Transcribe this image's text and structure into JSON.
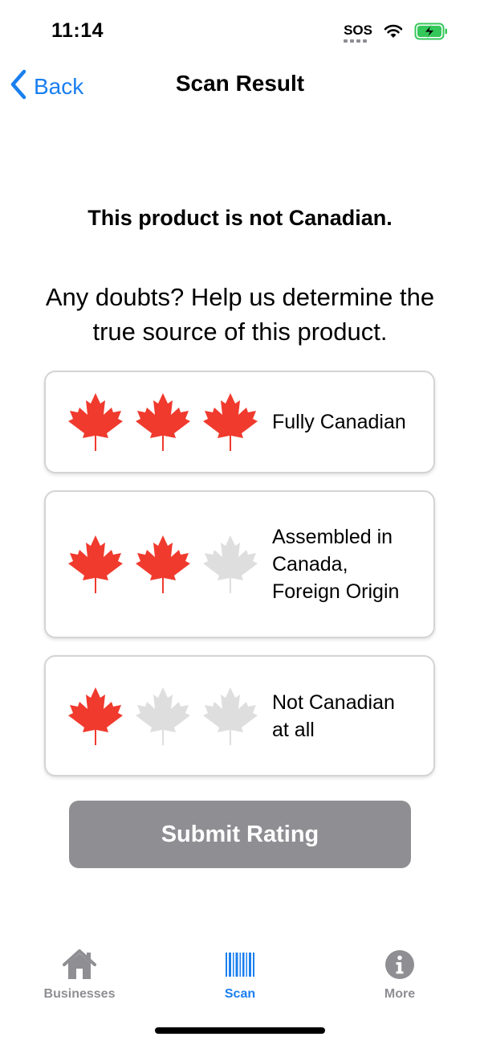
{
  "status_bar": {
    "time": "11:14",
    "sos": "SOS"
  },
  "nav": {
    "back_label": "Back",
    "title": "Scan Result"
  },
  "headline": "This product is not Canadian.",
  "prompt": "Any doubts? Help us determine the true source of this product.",
  "options": [
    {
      "label": "Fully Canadian",
      "rating": 3,
      "max": 3
    },
    {
      "label": "Assembled in Canada, Foreign Origin",
      "rating": 2,
      "max": 3
    },
    {
      "label": "Not Canadian at all",
      "rating": 1,
      "max": 3
    }
  ],
  "submit_label": "Submit Rating",
  "tabs": [
    {
      "label": "Businesses",
      "icon": "house-icon",
      "active": false
    },
    {
      "label": "Scan",
      "icon": "barcode-icon",
      "active": true
    },
    {
      "label": "More",
      "icon": "info-icon",
      "active": false
    }
  ],
  "colors": {
    "accent": "#1a7ff0",
    "leaf_active": "#f03a2e",
    "leaf_inactive": "#dedede",
    "submit_bg": "#8e8e93",
    "tab_inactive": "#8e8e93"
  }
}
